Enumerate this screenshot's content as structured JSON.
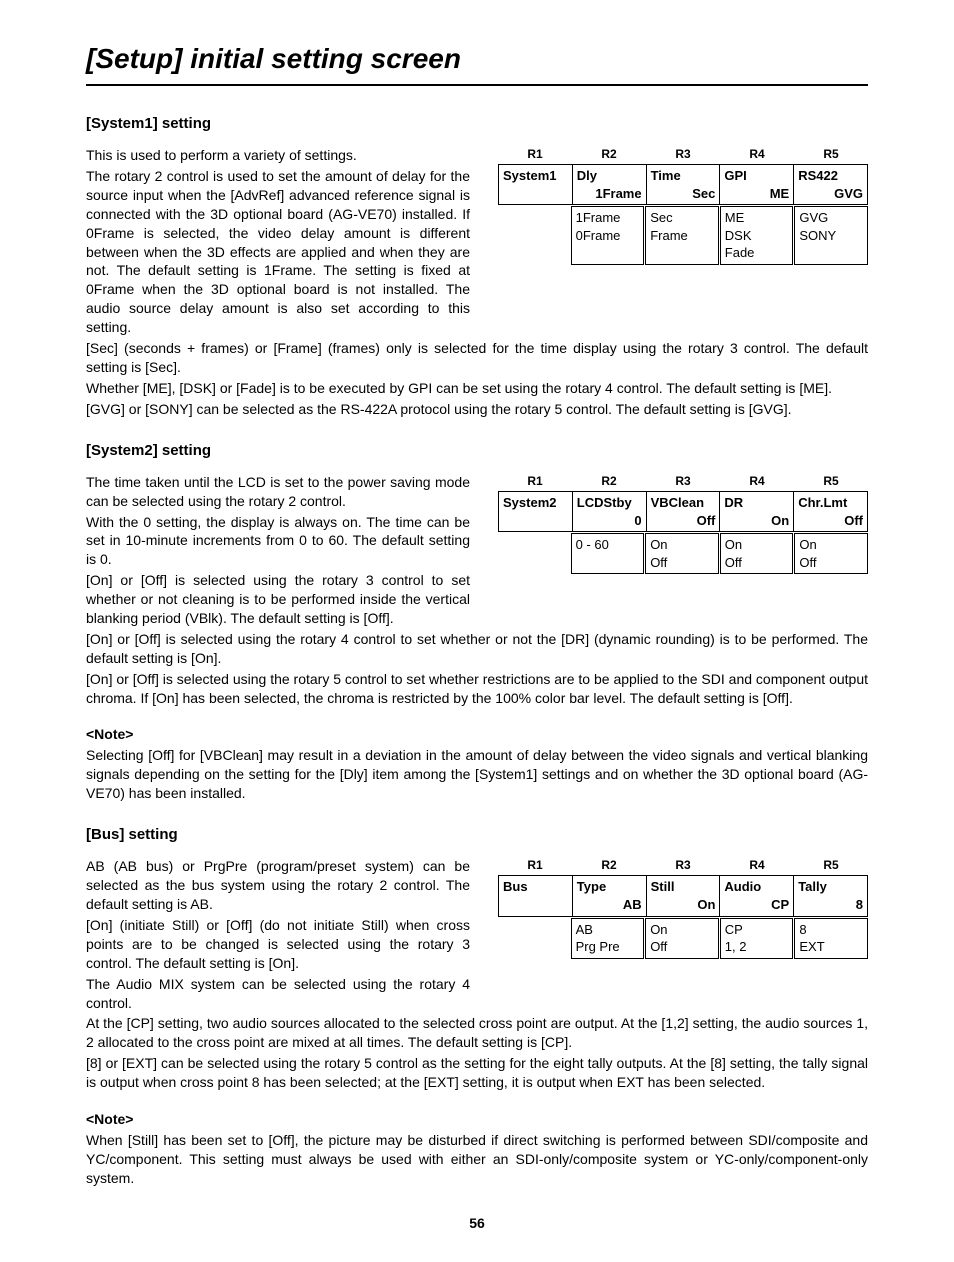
{
  "title": "[Setup] initial setting screen",
  "page_number": "56",
  "s1": {
    "heading": "[System1] setting",
    "p1": "This is used to perform a variety of settings.",
    "p2": "The rotary 2 control is used to set the amount of delay for the source input when the [AdvRef] advanced reference signal is connected with the 3D optional board (AG-VE70) installed.  If 0Frame is selected, the video delay amount is different between when the 3D effects are applied and when they are not.  The default setting is 1Frame.  The setting is fixed at 0Frame when the 3D optional board is not installed.  The audio source delay amount is also set according to this setting.",
    "p3": "[Sec] (seconds + frames) or [Frame] (frames) only is selected for the time display using the rotary 3 control.  The default setting is [Sec].",
    "p4": "Whether [ME], [DSK] or [Fade] is to be executed by GPI can be set using the rotary 4 control.  The default setting is [ME].",
    "p5": "[GVG] or [SONY] can be selected as the RS-422A protocol using the rotary 5 control.  The default setting is [GVG].",
    "rot": {
      "r1": "R1",
      "r2": "R2",
      "r3": "R3",
      "r4": "R4",
      "r5": "R5"
    },
    "menu": {
      "c1l": "System1",
      "c2l": "Dly",
      "c2v": "1Frame",
      "c3l": "Time",
      "c3v": "Sec",
      "c4l": "GPI",
      "c4v": "ME",
      "c5l": "RS422",
      "c5v": "GVG"
    },
    "opt": {
      "c2a": "1Frame",
      "c2b": "0Frame",
      "c3a": "Sec",
      "c3b": "Frame",
      "c4a": "ME",
      "c4b": "DSK",
      "c4c": "Fade",
      "c5a": "GVG",
      "c5b": "SONY"
    }
  },
  "s2": {
    "heading": "[System2] setting",
    "p1": "The time taken until the LCD is set to the power saving mode can be selected using the rotary 2 control.",
    "p2": "With the 0 setting, the display is always on.  The time can be set in 10-minute increments from 0 to 60.  The default setting is 0.",
    "p3": "[On] or [Off] is selected using the rotary 3 control to set whether or not cleaning is to be performed inside the vertical blanking period (VBlk).  The default setting is [Off].",
    "p4": "[On] or [Off] is selected using the rotary 4 control to set whether or not the [DR] (dynamic rounding) is to be performed.  The default setting is [On].",
    "p5": "[On] or [Off] is selected using the rotary 5 control to set whether restrictions are to be applied to the SDI and component output chroma.  If [On] has been selected, the chroma is restricted by the 100% color bar level.  The default setting is [Off].",
    "noteHead": "<Note>",
    "note": "Selecting [Off] for [VBClean] may result in a deviation in the amount of delay between the video signals and vertical blanking signals depending on the setting for the [Dly] item among the [System1] settings and on whether the 3D optional board (AG-VE70) has been installed.",
    "menu": {
      "c1l": "System2",
      "c2l": "LCDStby",
      "c2v": "0",
      "c3l": "VBClean",
      "c3v": "Off",
      "c4l": "DR",
      "c4v": "On",
      "c5l": "Chr.Lmt",
      "c5v": "Off"
    },
    "opt": {
      "c2a": "0 - 60",
      "c3a": "On",
      "c3b": "Off",
      "c4a": "On",
      "c4b": "Off",
      "c5a": "On",
      "c5b": "Off"
    }
  },
  "s3": {
    "heading": "[Bus] setting",
    "p1": "AB (AB bus) or PrgPre (program/preset system) can be selected as the bus system using the rotary 2 control.  The default setting is AB.",
    "p2": "[On] (initiate Still) or [Off] (do not initiate Still) when cross points are to be changed is selected using the rotary 3 control.  The default setting is [On].",
    "p3": "The Audio MIX system can be selected using the rotary 4 control.",
    "p4": "At the [CP] setting, two audio sources allocated to the selected cross point are output. At the [1,2] setting, the audio sources 1, 2 allocated to the cross point are mixed at all times.  The default setting is [CP].",
    "p5": "[8] or [EXT] can be selected using the rotary 5 control as the setting for the eight tally outputs. At the [8] setting, the tally signal is output when cross point 8 has been selected; at the [EXT] setting, it is output when EXT has been selected.",
    "noteHead": "<Note>",
    "note": "When [Still] has been set to [Off], the picture may be disturbed if direct switching is performed between SDI/composite and YC/component.  This setting must always be used with either an SDI-only/composite system or YC-only/component-only system.",
    "menu": {
      "c1l": "Bus",
      "c2l": "Type",
      "c2v": "AB",
      "c3l": "Still",
      "c3v": "On",
      "c4l": "Audio",
      "c4v": "CP",
      "c5l": "Tally",
      "c5v": "8"
    },
    "opt": {
      "c2a": "AB",
      "c2b": "Prg Pre",
      "c3a": "On",
      "c3b": "Off",
      "c4a": "CP",
      "c4b": "1, 2",
      "c5a": "8",
      "c5b": "EXT"
    }
  }
}
